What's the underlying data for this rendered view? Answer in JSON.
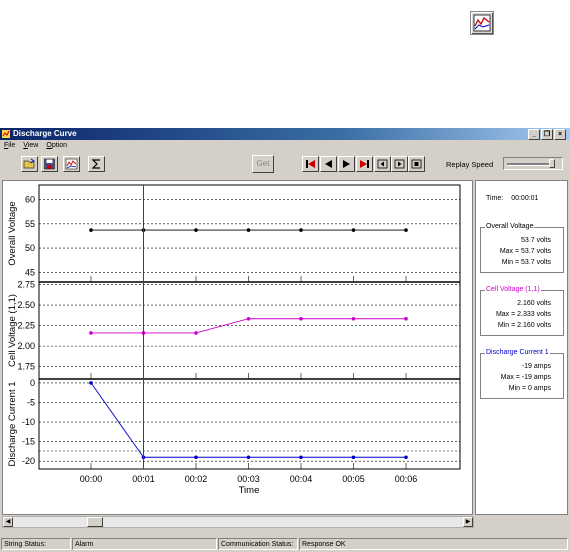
{
  "window": {
    "title": "Discharge Curve"
  },
  "menu": [
    "File",
    "View",
    "Option"
  ],
  "toolbar": {
    "get_label": "Get",
    "replay_speed_label": "Replay Speed",
    "replay_speed_value": 0.9
  },
  "info": {
    "time_label": "Time:",
    "time_value": "00:00:01",
    "overall_voltage": {
      "title": "Overall Voltage",
      "value": "53.7 volts",
      "max": "Max = 53.7 volts",
      "min": "Min = 53.7 volts",
      "color": "#000000"
    },
    "cell_voltage": {
      "title": "Cell Voltage (1,1)",
      "value": "2.160 volts",
      "max": "Max = 2.333 volts",
      "min": "Min = 2.160 volts",
      "color": "#cc00cc"
    },
    "discharge_current": {
      "title": "Discharge Current 1",
      "value": "-19 amps",
      "max": "Max = -19 amps",
      "min": "Min = 0 amps",
      "color": "#0000cc"
    }
  },
  "status": {
    "string_status_label": "String Status:",
    "string_status_value": "Alarm",
    "comm_status_label": "Communication Status:",
    "comm_status_value": "Response OK"
  },
  "chart_data": [
    {
      "type": "line",
      "ylabel": "Overall Voltage",
      "ylim": [
        43,
        63
      ],
      "yticks": [
        45,
        50,
        55,
        60
      ],
      "x": [
        "00:00",
        "00:01",
        "00:02",
        "00:03",
        "00:04",
        "00:05",
        "00:06"
      ],
      "values": [
        53.7,
        53.7,
        53.7,
        53.7,
        53.7,
        53.7,
        53.7
      ],
      "color": "#000000"
    },
    {
      "type": "line",
      "ylabel": "Cell Voltage (1,1)",
      "ylim": [
        1.6,
        2.78
      ],
      "yticks": [
        1.75,
        2.0,
        2.25,
        2.5,
        2.75
      ],
      "ytick_labels": [
        "1.75",
        "2.00",
        "2.25",
        "2.50",
        "2.75"
      ],
      "x": [
        "00:00",
        "00:01",
        "00:02",
        "00:03",
        "00:04",
        "00:05",
        "00:06"
      ],
      "values": [
        2.16,
        2.16,
        2.16,
        2.333,
        2.333,
        2.333,
        2.333
      ],
      "color": "#cc00cc"
    },
    {
      "type": "line",
      "ylabel": "Discharge Current 1",
      "ylim": [
        -22,
        1
      ],
      "yticks": [
        -20,
        -15,
        -10,
        -5,
        0
      ],
      "x": [
        "00:00",
        "00:01",
        "00:02",
        "00:03",
        "00:04",
        "00:05",
        "00:06"
      ],
      "values": [
        0,
        -19,
        -19,
        -19,
        -19,
        -19,
        -19
      ],
      "color": "#0000cc"
    }
  ],
  "chart_xlabel": "Time",
  "chart_cursor": "00:01"
}
